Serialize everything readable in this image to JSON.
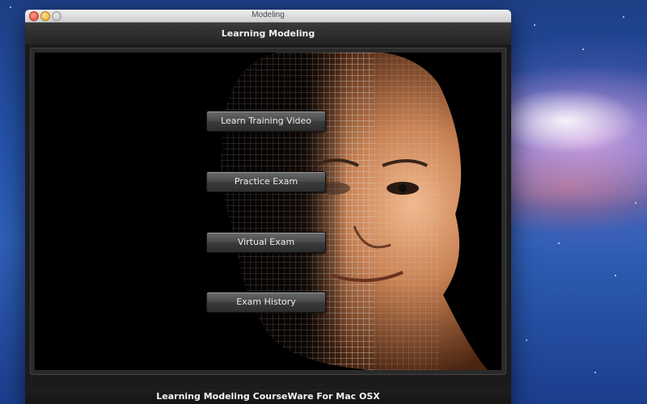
{
  "window": {
    "title": "Modeling"
  },
  "header": {
    "title": "Learning Modeling"
  },
  "menu": {
    "learn_training_video": "Learn Training Video",
    "practice_exam": "Practice Exam",
    "virtual_exam": "Virtual Exam",
    "exam_history": "Exam History"
  },
  "footer": {
    "text": "Learning Modeling CourseWare For Mac OSX"
  },
  "colors": {
    "accent": "#e8a06a",
    "panel": "#1b1b1b"
  },
  "icons": {
    "close": "close-icon",
    "minimize": "minimize-icon",
    "zoom": "zoom-icon"
  }
}
